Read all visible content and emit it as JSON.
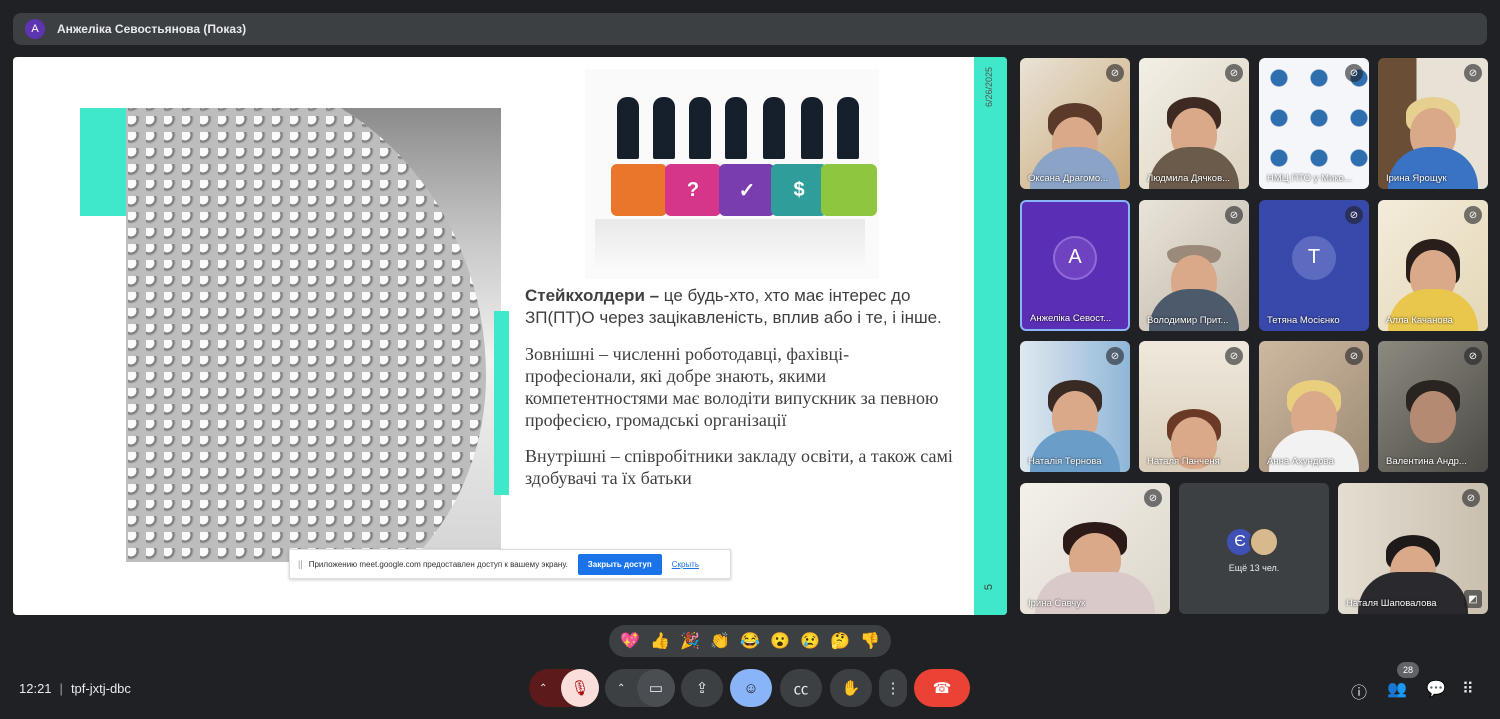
{
  "header": {
    "presenter_initial": "А",
    "title": "Анжеліка Севостьянова (Показ)"
  },
  "slide": {
    "date": "6/26/2025",
    "page_number": "5",
    "paragraph1_bold": "Стейкхолдери –",
    "paragraph1_text": " це будь-хто, хто має інтерес до ЗП(ПТ)О через зацікавленість, вплив або і те, і інше.",
    "paragraph2": "Зовнішні – численні роботодавці, фахівці-професіонали, які добре знають, якими компетентностями має володіти випускник за певною професією, громадські організації",
    "paragraph3": "Внутрішні – співробітники закладу освіти, а також самі здобувачі та їх батьки",
    "puzzle_symbols": [
      "?",
      "✓",
      "$"
    ]
  },
  "share_notice": {
    "grip": "||",
    "text": "Приложению meet.google.com предоставлен доступ к вашему экрану.",
    "stop_label": "Закрыть доступ",
    "hide_label": "Скрыть"
  },
  "participants": [
    {
      "name": "Оксана Драгомо...",
      "muted": true
    },
    {
      "name": "Людмила Дячков...",
      "muted": true
    },
    {
      "name": "НМЦ ПТО у Мико...",
      "muted": true
    },
    {
      "name": "Ірина Ярощук",
      "muted": true
    },
    {
      "name": "Анжеліка Севост...",
      "initial": "А",
      "muted": false
    },
    {
      "name": "Володимир Прит...",
      "muted": true
    },
    {
      "name": "Тетяна Мосієнко",
      "initial": "Т",
      "muted": true
    },
    {
      "name": "Алла Качанова",
      "muted": true
    },
    {
      "name": "Наталія Тернова",
      "muted": true
    },
    {
      "name": "Наталя Панченя",
      "muted": true
    },
    {
      "name": "Анна Ахундова",
      "muted": true
    },
    {
      "name": "Валентина Андр...",
      "muted": true
    },
    {
      "name": "Ірина Савчук",
      "muted": true
    },
    {
      "name": "Наталя Шаповалова",
      "muted": true
    }
  ],
  "more_tile": {
    "initial": "Є",
    "label": "Ещё 13 чел."
  },
  "reactions": [
    "💖",
    "👍",
    "🎉",
    "👏",
    "😂",
    "😮",
    "😢",
    "🤔",
    "👎"
  ],
  "meeting": {
    "time": "12:21",
    "code": "tpf-jxtj-dbc",
    "participant_count": "28"
  },
  "icons": {
    "mic_off": "mic-off-icon",
    "camera": "camera-icon",
    "present": "present-icon",
    "emoji": "emoji-icon",
    "captions": "captions-icon",
    "hand": "raise-hand-icon",
    "more": "more-options-icon",
    "end_call": "end-call-icon",
    "info": "info-icon",
    "people": "people-icon",
    "chat": "chat-icon",
    "activities": "activities-icon"
  },
  "colors": {
    "teal": "#3ee8c8",
    "end_call": "#ea4335",
    "active_blue": "#8ab4f8",
    "mic_off_red": "#f9dedc"
  }
}
